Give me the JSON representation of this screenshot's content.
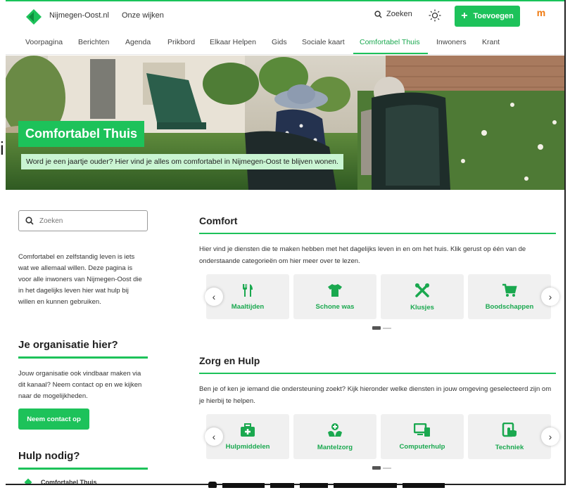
{
  "header": {
    "site_name": "Nijmegen-Oost.nl",
    "wijken_label": "Onze wijken",
    "search_label": "Zoeken",
    "add_label": "Toevoegen",
    "partner_logo": "m"
  },
  "nav": {
    "items": [
      "Voorpagina",
      "Berichten",
      "Agenda",
      "Prikbord",
      "Elkaar Helpen",
      "Gids",
      "Sociale kaart",
      "Comfortabel Thuis",
      "Inwoners",
      "Krant"
    ],
    "active": "Comfortabel Thuis"
  },
  "hero": {
    "title": "Comfortabel Thuis",
    "subtitle": "Word je een jaartje ouder? Hier vind je alles om comfortabel in Nijmegen-Oost te blijven wonen."
  },
  "sidebar": {
    "search_placeholder": "Zoeken",
    "intro": "Comfortabel en zelfstandig leven is iets wat we allemaal willen. Deze pagina is voor alle inwoners van Nijmegen-Oost die in het dagelijks leven hier wat hulp bij willen en kunnen gebruiken.",
    "org_heading": "Je organisatie hier?",
    "org_text": "Jouw organisatie ook vindbaar maken via dit kanaal? Neem contact op en we kijken naar de mogelijkheden.",
    "contact_button": "Neem contact op",
    "help_heading": "Hulp nodig?",
    "help_link": "Comfortabel Thuis"
  },
  "sections": {
    "comfort": {
      "heading": "Comfort",
      "text": "Hier vind je diensten die te maken hebben met het dagelijks leven in en om het huis. Klik gerust op één van de onderstaande categorieën om hier meer over te lezen.",
      "cards": [
        "Maaltijden",
        "Schone was",
        "Klusjes",
        "Boodschappen"
      ]
    },
    "zorg": {
      "heading": "Zorg en Hulp",
      "text": "Ben je of ken je iemand die ondersteuning zoekt? Kijk hieronder welke diensten in jouw omgeving geselecteerd zijn om je hierbij te helpen.",
      "cards": [
        "Hulpmiddelen",
        "Mantelzorg",
        "Computerhulp",
        "Techniek"
      ]
    }
  },
  "icons": {
    "maaltijden": "cutlery-icon",
    "schone_was": "tshirt-icon",
    "klusjes": "tools-icon",
    "boodschappen": "cart-icon",
    "hulpmiddelen": "medkit-icon",
    "mantelzorg": "care-hands-icon",
    "computerhulp": "computer-icon",
    "techniek": "tablet-hand-icon"
  },
  "colors": {
    "accent": "#1dc25a",
    "accent_text": "#1aa84f",
    "hero_sub_bg": "#c9f4d2",
    "card_bg": "#f0f0f0"
  }
}
